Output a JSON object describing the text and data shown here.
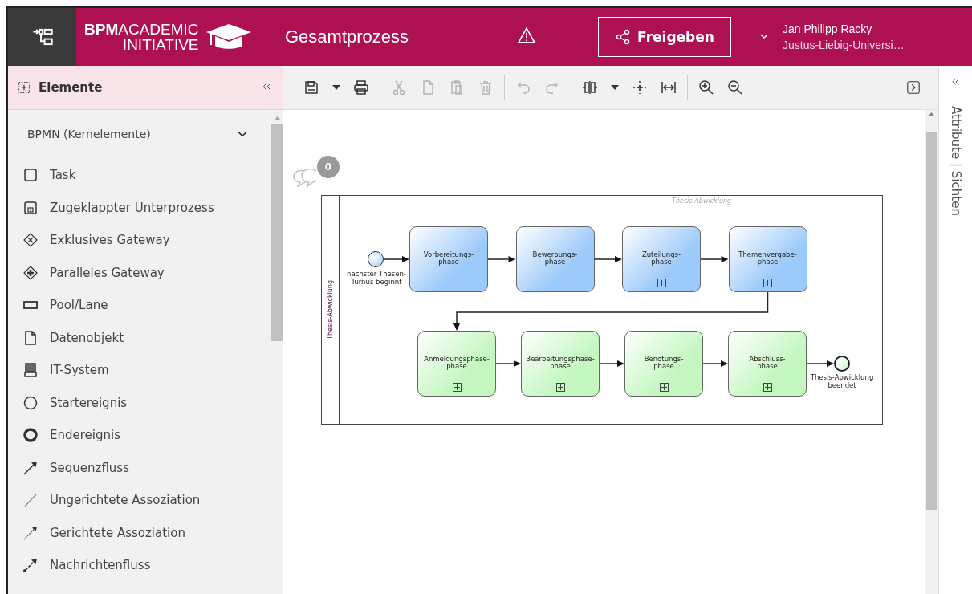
{
  "header": {
    "logo_lines": [
      "**BPM**ACADEMIC",
      "INITIATIVE"
    ],
    "title": "Gesamtprozess",
    "share_button": "Freigeben",
    "user": {
      "name": "Jan Philipp Racky",
      "organization": "Justus-Liebig-Universi…"
    }
  },
  "elements_panel": {
    "title": "Elemente",
    "palette": "BPMN (Kernelemente)",
    "items": [
      {
        "label": "Task"
      },
      {
        "label": "Zugeklappter Unterprozess"
      },
      {
        "label": "Exklusives Gateway"
      },
      {
        "label": "Paralleles Gateway"
      },
      {
        "label": "Pool/Lane"
      },
      {
        "label": "Datenobjekt"
      },
      {
        "label": "IT-System"
      },
      {
        "label": "Startereignis"
      },
      {
        "label": "Endereignis"
      },
      {
        "label": "Sequenzfluss"
      },
      {
        "label": "Ungerichtete Assoziation"
      },
      {
        "label": "Gerichtete Assoziation"
      },
      {
        "label": "Nachrichtenfluss"
      }
    ]
  },
  "toolbar": {
    "groups": [
      [
        {
          "disabled": false
        },
        {
          "disabled": false
        },
        {
          "disabled": false
        }
      ],
      [
        {
          "disabled": true
        },
        {
          "disabled": true
        },
        {
          "disabled": true
        },
        {
          "disabled": true
        }
      ],
      [
        {
          "disabled": true
        },
        {
          "disabled": true
        }
      ],
      [
        {
          "disabled": false
        },
        {
          "disabled": false
        },
        {
          "disabled": false
        },
        {
          "disabled": false
        }
      ],
      [
        {
          "disabled": false
        },
        {
          "disabled": false
        }
      ]
    ]
  },
  "side_panel": {
    "title": "Attribute | Sichten"
  },
  "canvas": {
    "comments": {
      "count": "0"
    },
    "pool": {
      "title": "Thesis-Abwicklung",
      "lane_label": "Thesis-Abwicklung"
    },
    "start_event": {
      "lines": [
        "nächster Thesen-",
        "Turnus beginnt"
      ]
    },
    "task_rows": [
      [
        {
          "lines": [
            "Vorbereitungs-",
            "phase"
          ],
          "color": "#9ccafa"
        },
        {
          "lines": [
            "Bewerbungs-",
            "phase"
          ],
          "color": "#9ccafa"
        },
        {
          "lines": [
            "Zuteilungs-",
            "phase"
          ],
          "color": "#9ccafa"
        },
        {
          "lines": [
            "Themenvergabe-",
            "phase"
          ],
          "color": "#9ccafa"
        }
      ],
      [
        {
          "lines": [
            "Anmeldungsphase-",
            "phase"
          ],
          "color": "#c4f7c0"
        },
        {
          "lines": [
            "Bearbeitungsphase-",
            "phase"
          ],
          "color": "#c4f7c0"
        },
        {
          "lines": [
            "Benotungs-",
            "phase"
          ],
          "color": "#c4f7c0"
        },
        {
          "lines": [
            "Abschluss-",
            "phase"
          ],
          "color": "#c4f7c0"
        }
      ]
    ],
    "end_event": {
      "lines": [
        "Thesis-Abwicklung",
        "beendet"
      ]
    }
  }
}
